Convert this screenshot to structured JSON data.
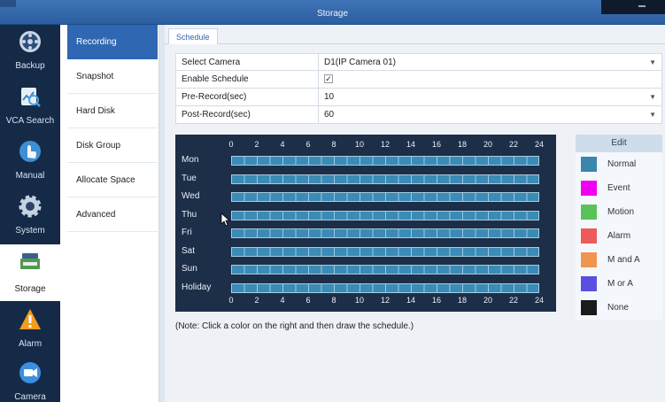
{
  "window": {
    "title": "Storage"
  },
  "nav": [
    {
      "label": "Backup",
      "icon": "backup-icon"
    },
    {
      "label": "VCA Search",
      "icon": "vca-search-icon"
    },
    {
      "label": "Manual",
      "icon": "manual-icon"
    },
    {
      "label": "System",
      "icon": "gear-icon"
    },
    {
      "label": "Storage",
      "icon": "storage-icon",
      "active": true
    },
    {
      "label": "Alarm",
      "icon": "warning-icon"
    },
    {
      "label": "Camera",
      "icon": "camera-icon"
    }
  ],
  "submenu": [
    {
      "label": "Recording",
      "active": true
    },
    {
      "label": "Snapshot"
    },
    {
      "label": "Hard Disk"
    },
    {
      "label": "Disk Group"
    },
    {
      "label": "Allocate Space"
    },
    {
      "label": "Advanced"
    }
  ],
  "tab": {
    "label": "Schedule"
  },
  "form": {
    "select_camera": {
      "label": "Select Camera",
      "value": "D1(IP Camera 01)"
    },
    "enable_schedule": {
      "label": "Enable Schedule",
      "checked": true,
      "mark": "✓"
    },
    "pre_record": {
      "label": "Pre-Record(sec)",
      "value": "10"
    },
    "post_record": {
      "label": "Post-Record(sec)",
      "value": "60"
    }
  },
  "schedule": {
    "hours": [
      "0",
      "2",
      "4",
      "6",
      "8",
      "10",
      "12",
      "14",
      "16",
      "18",
      "20",
      "22",
      "24"
    ],
    "days": [
      "Mon",
      "Tue",
      "Wed",
      "Thu",
      "Fri",
      "Sat",
      "Sun",
      "Holiday"
    ],
    "fill_type": "Normal",
    "fill_fraction": 1.0
  },
  "legend": {
    "header": "Edit",
    "items": [
      {
        "label": "Normal",
        "color": "#3a86ad"
      },
      {
        "label": "Event",
        "color": "#f000f0"
      },
      {
        "label": "Motion",
        "color": "#59c25a"
      },
      {
        "label": "Alarm",
        "color": "#ee5a5a"
      },
      {
        "label": "M and A",
        "color": "#f0954f"
      },
      {
        "label": "M or A",
        "color": "#5a4fe0"
      },
      {
        "label": "None",
        "color": "#1b1b1b"
      }
    ]
  },
  "note": "(Note: Click a color on the right and then draw the schedule.)"
}
